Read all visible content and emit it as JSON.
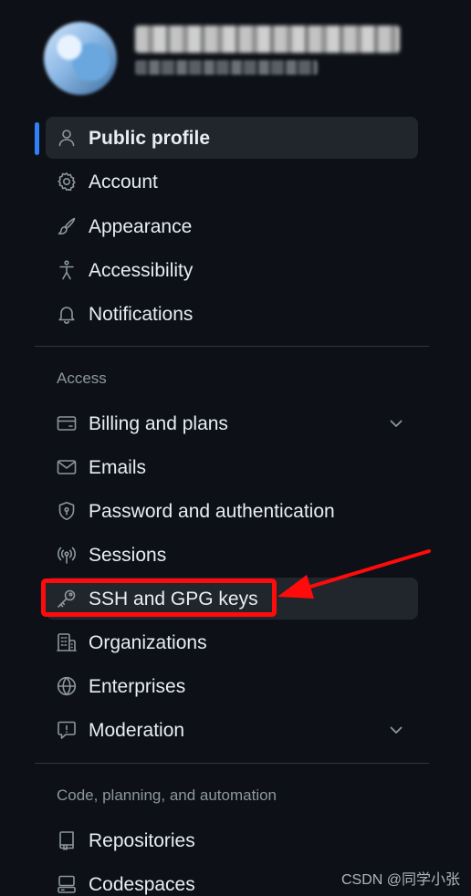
{
  "menu": {
    "items": [
      {
        "label": "Public profile",
        "icon": "person-icon",
        "active": true
      },
      {
        "label": "Account",
        "icon": "gear-icon"
      },
      {
        "label": "Appearance",
        "icon": "paintbrush-icon"
      },
      {
        "label": "Accessibility",
        "icon": "accessibility-icon"
      },
      {
        "label": "Notifications",
        "icon": "bell-icon"
      }
    ]
  },
  "access": {
    "heading": "Access",
    "items": [
      {
        "label": "Billing and plans",
        "icon": "credit-card-icon",
        "expandable": true
      },
      {
        "label": "Emails",
        "icon": "mail-icon"
      },
      {
        "label": "Password and authentication",
        "icon": "shield-lock-icon"
      },
      {
        "label": "Sessions",
        "icon": "broadcast-icon"
      },
      {
        "label": "SSH and GPG keys",
        "icon": "key-icon",
        "hovered": true,
        "annotated": true
      },
      {
        "label": "Organizations",
        "icon": "organization-icon"
      },
      {
        "label": "Enterprises",
        "icon": "globe-icon"
      },
      {
        "label": "Moderation",
        "icon": "report-icon",
        "expandable": true
      }
    ]
  },
  "code": {
    "heading": "Code, planning, and automation",
    "items": [
      {
        "label": "Repositories",
        "icon": "repo-icon"
      },
      {
        "label": "Codespaces",
        "icon": "codespaces-icon"
      }
    ]
  },
  "watermark": "CSDN @同学小张",
  "colors": {
    "background": "#0d1117",
    "active_indicator": "#2f81f7",
    "annotation": "#ff0b0b"
  }
}
